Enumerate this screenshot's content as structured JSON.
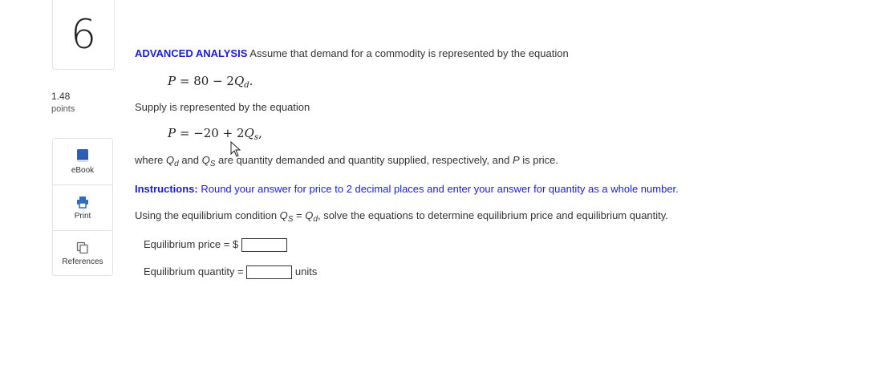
{
  "question": {
    "number": "6",
    "points_value": "1.48",
    "points_label": "points"
  },
  "tools": [
    {
      "label": "eBook",
      "icon": "book-icon"
    },
    {
      "label": "Print",
      "icon": "printer-icon"
    },
    {
      "label": "References",
      "icon": "copy-icon"
    }
  ],
  "body": {
    "heading": "ADVANCED ANALYSIS",
    "intro": " Assume that demand for a commodity is represented by the equation",
    "demand_eq": {
      "lhs": "P",
      "rhs": " = 80 − 2",
      "var": "Q",
      "sub": "d",
      "end": "."
    },
    "supply_text": "Supply is represented by the equation",
    "supply_eq": {
      "lhs": "P",
      "rhs": " = −20 + 2",
      "var": "Q",
      "sub": "s",
      "end": ","
    },
    "where_parts": {
      "w1": "where ",
      "qd": "Q",
      "qd_sub": "d",
      "w2": " and ",
      "qs": "Q",
      "qs_sub": "S",
      "w3": " are quantity demanded and quantity supplied, respectively, and ",
      "p": "P",
      "w4": " is price."
    },
    "instructions_label": "Instructions:",
    "instructions_text": " Round your answer for price to 2 decimal places and enter your answer for quantity as a whole number.",
    "using_parts": {
      "u1": "Using the equilibrium condition ",
      "qs": "Q",
      "qs_sub": "S",
      "eq": " = ",
      "qd": "Q",
      "qd_sub": "d",
      "u2": ", solve the equations to determine equilibrium price and equilibrium quantity."
    },
    "price_label": "Equilibrium price = $",
    "price_value": "",
    "quantity_label": "Equilibrium quantity =",
    "quantity_value": "",
    "quantity_units": "units"
  },
  "colors": {
    "accent_blue": "#1a1adb",
    "ebook_blue": "#2b5fb4",
    "print_blue": "#2b6cc4"
  }
}
